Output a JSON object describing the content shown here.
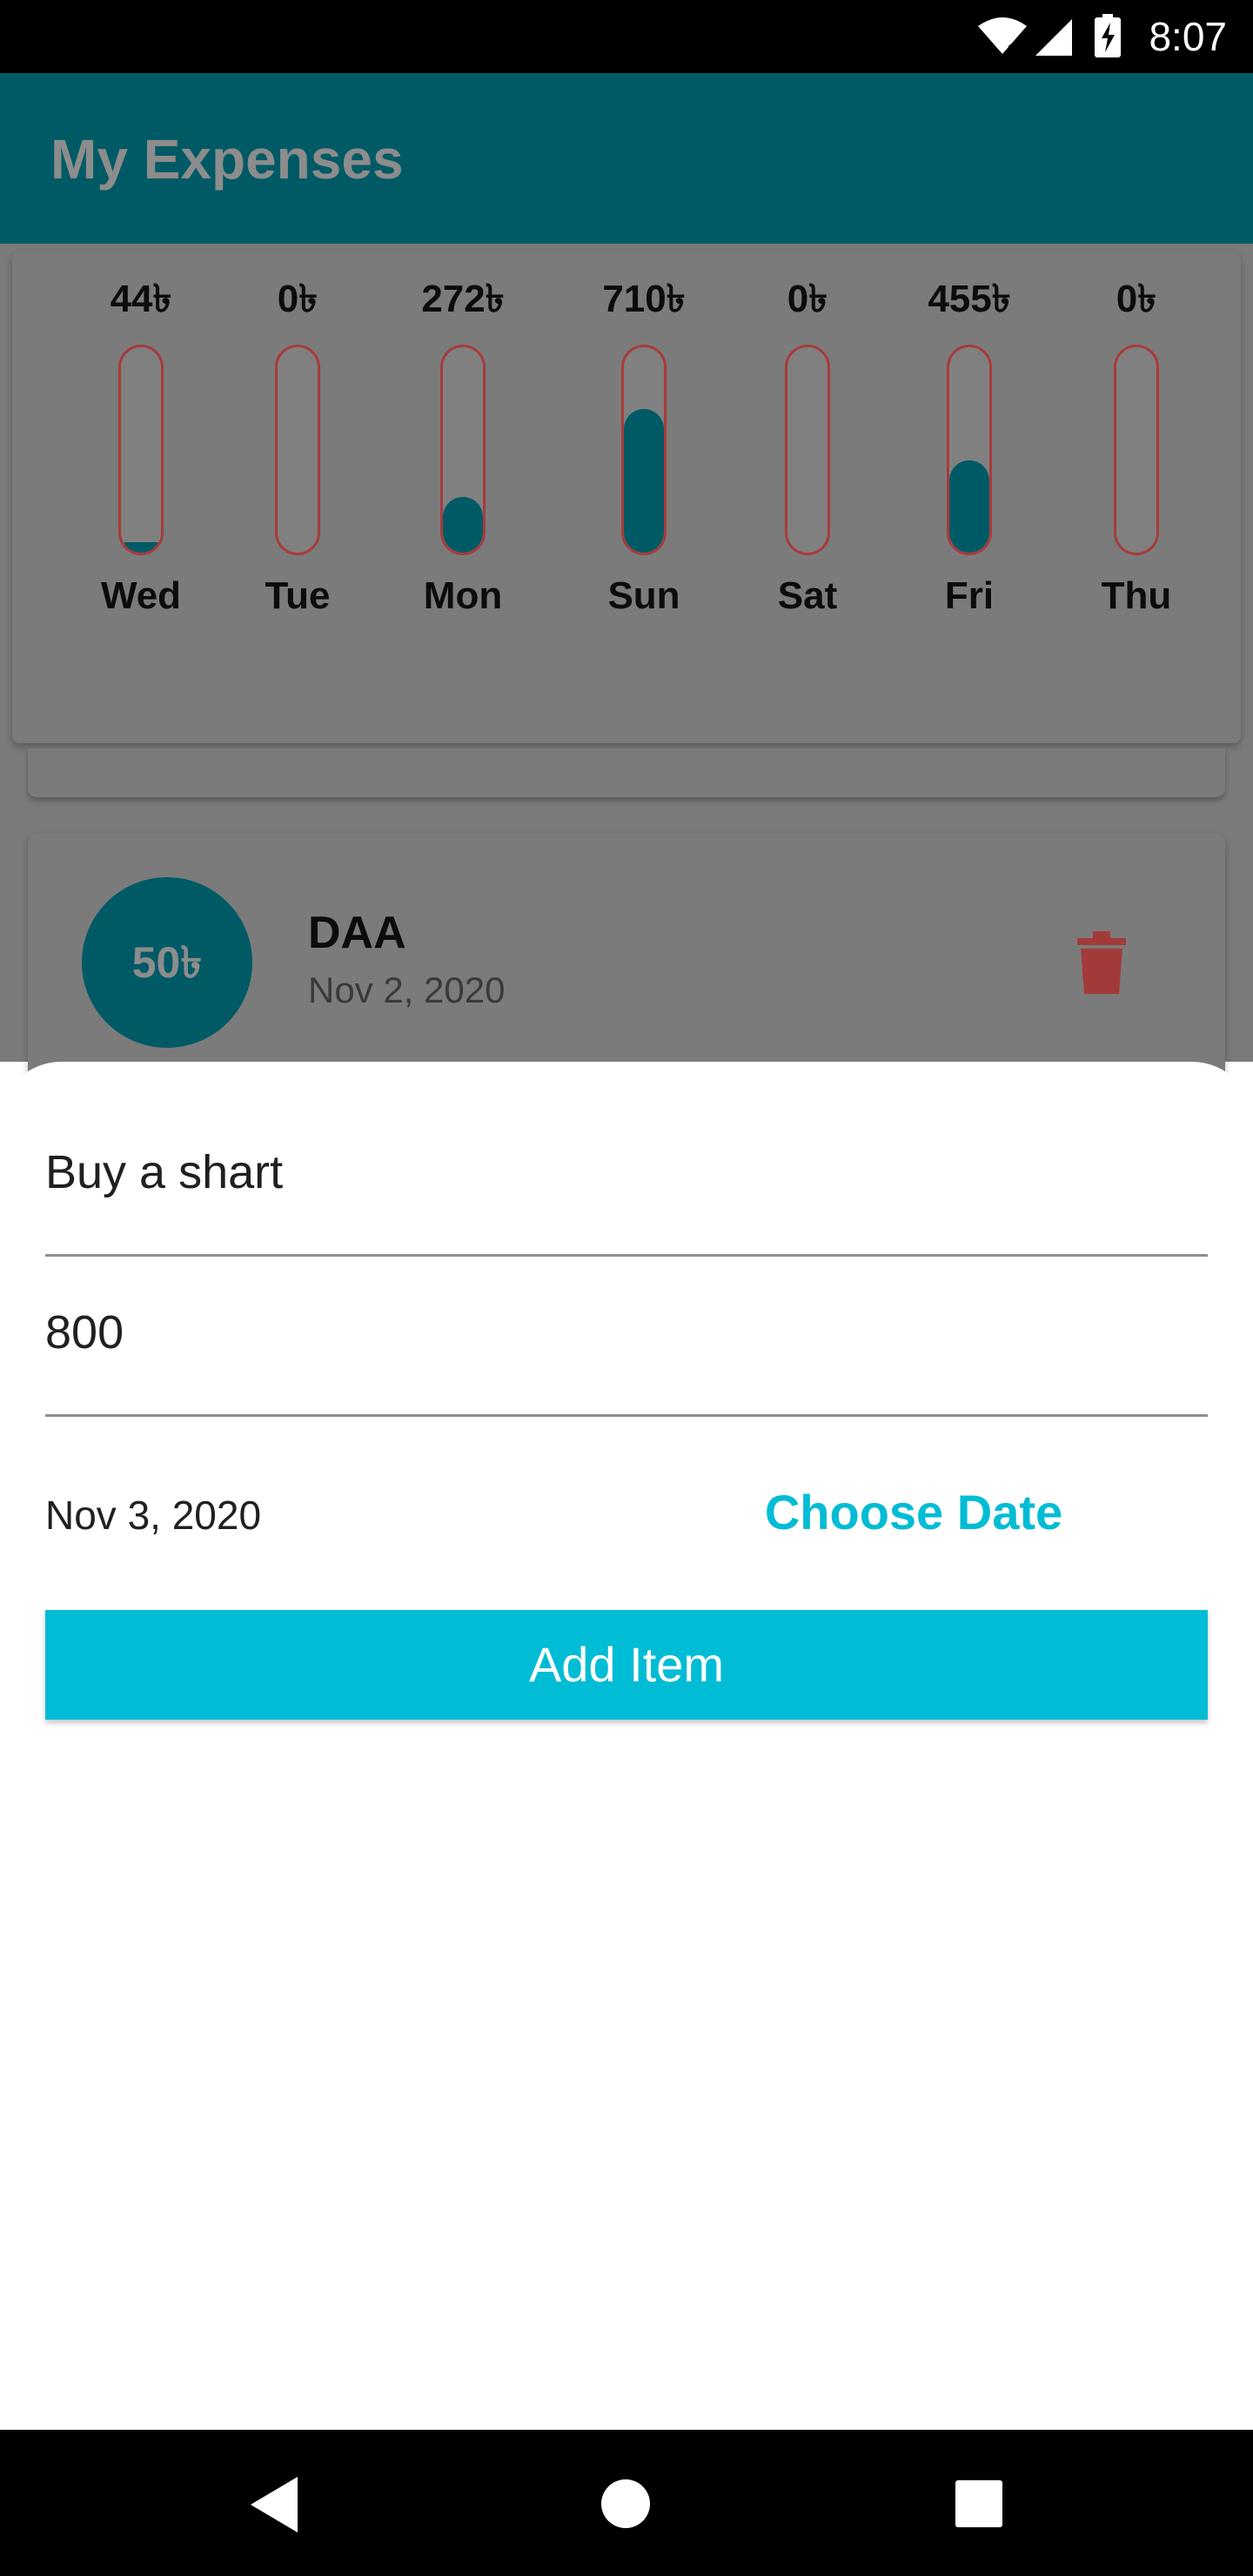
{
  "status_bar": {
    "time": "8:07",
    "icons": [
      "wifi-no-internet-icon",
      "signal-icon",
      "battery-charging-icon"
    ]
  },
  "app_bar": {
    "title": "My Expenses"
  },
  "weekly_chart": {
    "days": [
      {
        "amount": "44৳",
        "day": "Wed",
        "fill_fraction": 0.05
      },
      {
        "amount": "0৳",
        "day": "Tue",
        "fill_fraction": 0.0
      },
      {
        "amount": "272৳",
        "day": "Mon",
        "fill_fraction": 0.27
      },
      {
        "amount": "710৳",
        "day": "Sun",
        "fill_fraction": 0.7
      },
      {
        "amount": "0৳",
        "day": "Sat",
        "fill_fraction": 0.0
      },
      {
        "amount": "455৳",
        "day": "Fri",
        "fill_fraction": 0.45
      },
      {
        "amount": "0৳",
        "day": "Thu",
        "fill_fraction": 0.0
      }
    ],
    "colors": {
      "fill": "#005a66",
      "track_border": "#a83b3b"
    }
  },
  "transaction": {
    "amount": "50৳",
    "title": "DAA",
    "date": "Nov 2, 2020",
    "delete_icon": "trash-icon"
  },
  "new_expense_sheet": {
    "title_value": "Buy a shart",
    "amount_value": "800",
    "selected_date": "Nov 3, 2020",
    "choose_date_label": "Choose Date",
    "submit_label": "Add Item",
    "accent_color": "#00bcd4"
  },
  "nav_bar": {
    "icons": [
      "back-icon",
      "home-icon",
      "recents-icon"
    ]
  }
}
